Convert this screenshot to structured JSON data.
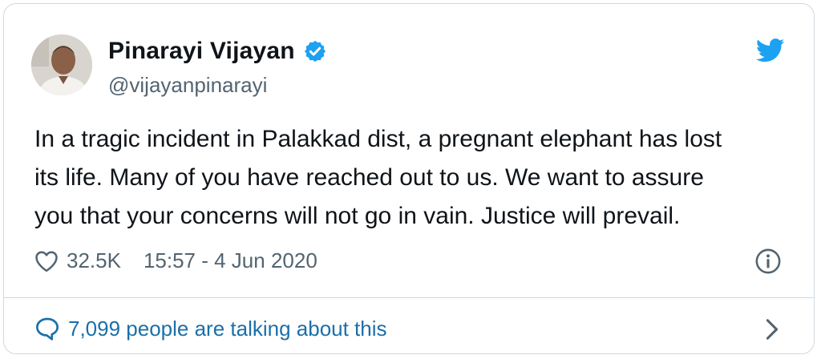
{
  "author": {
    "name": "Pinarayi Vijayan",
    "handle": "@vijayanpinarayi",
    "verified": true
  },
  "tweet": {
    "lines": [
      "In a tragic incident in Palakkad dist, a pregnant elephant has lost",
      "its life. Many of you have reached out to us. We want to assure",
      "you that your concerns will not go in vain. Justice will prevail."
    ],
    "likes": "32.5K",
    "timestamp": "15:57 - 4 Jun 2020"
  },
  "footer": {
    "talking": "7,099 people are talking about this"
  },
  "icons": {
    "verified": "verified-badge-icon",
    "twitter": "twitter-bird-icon",
    "like": "heart-icon",
    "info": "info-icon",
    "reply": "speech-bubble-icon",
    "chevron": "chevron-right-icon"
  },
  "colors": {
    "brand": "#1da1f2",
    "link": "#1b6fa8",
    "text": "#0f1419",
    "muted": "#536471"
  }
}
